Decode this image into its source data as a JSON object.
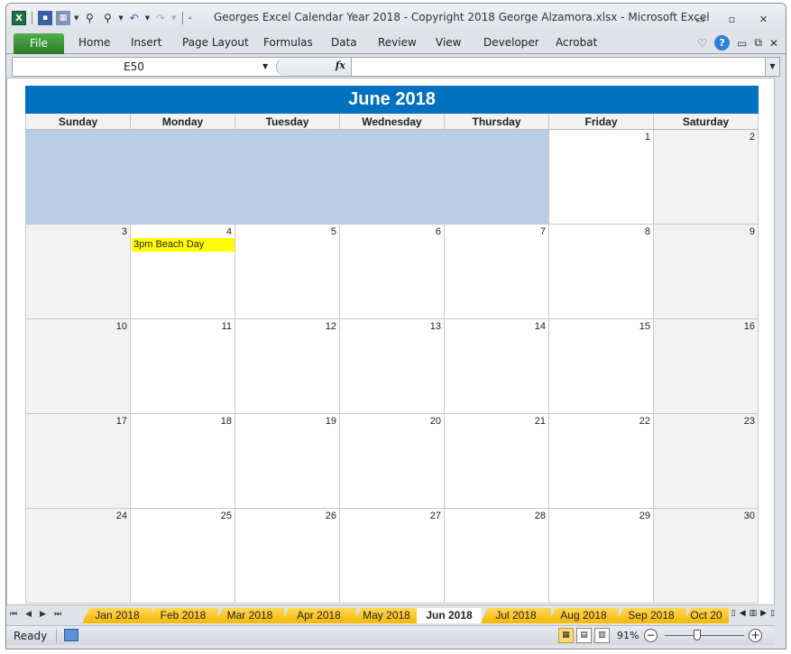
{
  "window": {
    "title": "Georges Excel Calendar Year 2018  -  Copyright 2018 George Alzamora.xlsx  -  Microsoft Excel",
    "controls": {
      "minimize": "▭",
      "restore": "▫",
      "close": "✕"
    }
  },
  "qat": {
    "app_icon": "X",
    "icons": [
      "save-icon",
      "calculator-icon",
      "find-icon",
      "find-replace-icon",
      "undo-icon",
      "redo-icon",
      "customize-icon"
    ]
  },
  "ribbon": {
    "file": "File",
    "tabs": [
      "Home",
      "Insert",
      "Page Layout",
      "Formulas",
      "Data",
      "Review",
      "View",
      "Developer",
      "Acrobat"
    ],
    "help": "?"
  },
  "formula_bar": {
    "name_box": "E50",
    "fx": "fx",
    "formula": ""
  },
  "calendar": {
    "month_title": "June 2018",
    "days": [
      "Sunday",
      "Monday",
      "Tuesday",
      "Wednesday",
      "Thursday",
      "Friday",
      "Saturday"
    ],
    "weeks": [
      [
        null,
        null,
        null,
        null,
        null,
        "1",
        "2"
      ],
      [
        "3",
        "4",
        "5",
        "6",
        "7",
        "8",
        "9"
      ],
      [
        "10",
        "11",
        "12",
        "13",
        "14",
        "15",
        "16"
      ],
      [
        "17",
        "18",
        "19",
        "20",
        "21",
        "22",
        "23"
      ],
      [
        "24",
        "25",
        "26",
        "27",
        "28",
        "29",
        "30"
      ]
    ],
    "events": [
      {
        "day": "4",
        "text": "3pm Beach Day",
        "color": "#ffff00"
      }
    ],
    "colors": {
      "header": "#0070c0",
      "blank": "#b8cce4",
      "weekend": "#f2f2f2"
    }
  },
  "sheet_tabs": {
    "tabs": [
      "Jan 2018",
      "Feb 2018",
      "Mar 2018",
      "Apr 2018",
      "May 2018",
      "Jun 2018",
      "Jul 2018",
      "Aug 2018",
      "Sep 2018",
      "Oct 20"
    ],
    "active": "Jun 2018",
    "tab_color": "#ffc000"
  },
  "status": {
    "ready": "Ready",
    "zoom": "91%",
    "zoom_minus": "−",
    "zoom_plus": "+"
  }
}
